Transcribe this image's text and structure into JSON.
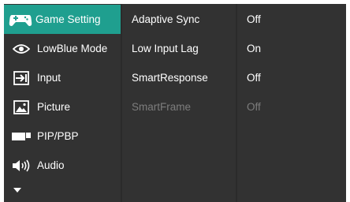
{
  "main_menu": {
    "items": [
      {
        "label": "Game Setting",
        "icon": "gamepad-icon",
        "active": true
      },
      {
        "label": "LowBlue Mode",
        "icon": "eye-icon"
      },
      {
        "label": "Input",
        "icon": "input-icon"
      },
      {
        "label": "Picture",
        "icon": "picture-icon"
      },
      {
        "label": "PIP/PBP",
        "icon": "pip-icon"
      },
      {
        "label": "Audio",
        "icon": "speaker-icon"
      }
    ],
    "more_icon": "chevron-down-icon"
  },
  "submenu": {
    "items": [
      {
        "label": "Adaptive Sync",
        "enabled": true
      },
      {
        "label": "Low Input Lag",
        "enabled": true
      },
      {
        "label": "SmartResponse",
        "enabled": true
      },
      {
        "label": "SmartFrame",
        "enabled": false
      }
    ]
  },
  "values": {
    "items": [
      {
        "label": "Off",
        "enabled": true
      },
      {
        "label": "On",
        "enabled": true
      },
      {
        "label": "Off",
        "enabled": true
      },
      {
        "label": "Off",
        "enabled": false
      }
    ]
  },
  "colors": {
    "accent": "#1f9f8f",
    "panel": "#323232",
    "divider": "#2b2b2b",
    "text": "#ffffff",
    "disabled_text": "#7d7d7d"
  }
}
